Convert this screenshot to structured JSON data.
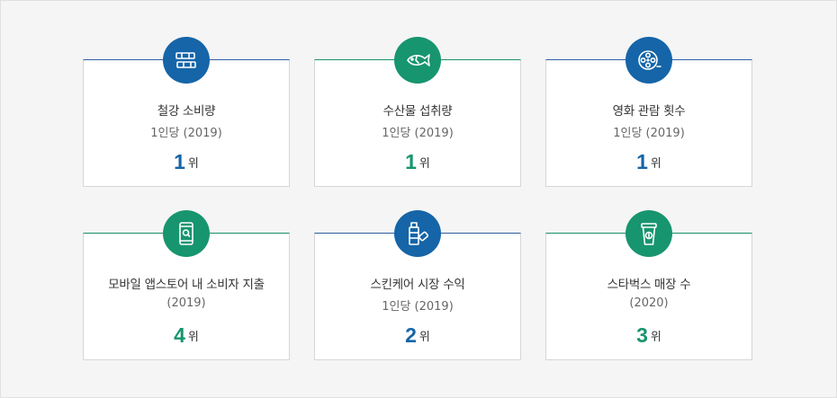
{
  "cards": [
    {
      "title": "철강 소비량",
      "subtitle": "1인당 (2019)",
      "rank": "1",
      "unit": "위",
      "icon": "steel-beam-icon",
      "color": "#1565a8"
    },
    {
      "title": "수산물 섭취량",
      "subtitle": "1인당 (2019)",
      "rank": "1",
      "unit": "위",
      "icon": "fish-icon",
      "color": "#17956e"
    },
    {
      "title": "영화 관람 횟수",
      "subtitle": "1인당 (2019)",
      "rank": "1",
      "unit": "위",
      "icon": "film-reel-icon",
      "color": "#1565a8"
    },
    {
      "title": "모바일 앱스토어 내 소비자 지출",
      "subtitle": "(2019)",
      "rank": "4",
      "unit": "위",
      "icon": "mobile-search-icon",
      "color": "#17956e"
    },
    {
      "title": "스킨케어 시장 수익",
      "subtitle": "1인당 (2019)",
      "rank": "2",
      "unit": "위",
      "icon": "skincare-bottle-icon",
      "color": "#1565a8"
    },
    {
      "title": "스타벅스 매장 수",
      "subtitle": "(2020)",
      "rank": "3",
      "unit": "위",
      "icon": "coffee-cup-icon",
      "color": "#17956e"
    }
  ]
}
